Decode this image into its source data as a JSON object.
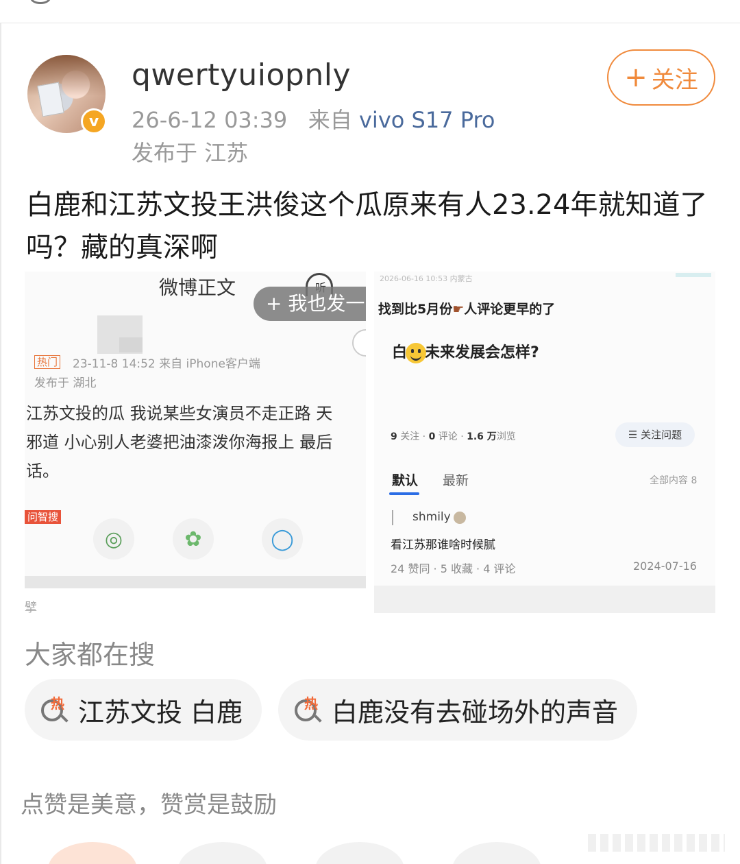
{
  "post": {
    "username": "qwertyuiopnly",
    "timestamp": "26-6-12 03:39",
    "source_prefix": "来自",
    "device": "vivo S17 Pro",
    "location": "发布于 江苏",
    "follow_label": "关注",
    "text": "白鹿和江苏文投王洪俊这个瓜原来有人23.24年就知道了吗？藏的真深啊"
  },
  "image1": {
    "title": "微博正文",
    "listen_label": "听",
    "pill_text": "+ 我也发一",
    "hot_tag": "热门",
    "meta": "23-11-8 14:52  来自 iPhone客户端",
    "location": "发布于 湖北",
    "body_lines": [
      "江苏文投的瓜 我说某些女演员不走正路 天",
      "邪道 小心别人老婆把油漆泼你海报上 最后",
      "话。"
    ],
    "wenzhi_tag": "问智搜",
    "below_char": "擘"
  },
  "image2": {
    "top_meta": "2026-06-16 10:53  内蒙古",
    "line1": "找到比5月份",
    "line1_b": "人评论更早的了",
    "question_a": "白",
    "question_b": "未来发展会怎样?",
    "stats": {
      "follow_num": "9",
      "follow_lbl": "关注",
      "comment_num": "0",
      "comment_lbl": "评论",
      "view_num": "1.6 万",
      "view_lbl": "浏览"
    },
    "follow_question": "关注问题",
    "tab_default": "默认",
    "tab_new": "最新",
    "all_content": "全部内容 8",
    "user": "shmily",
    "answer": "看江苏那谁啥时候腻",
    "footer": "24 赞同 · 5 收藏 · 4 评论",
    "date": "2024-07-16"
  },
  "search": {
    "title": "大家都在搜",
    "hot_mark": "热",
    "chips": [
      "江苏文投 白鹿",
      "白鹿没有去碰场外的声音"
    ]
  },
  "footer": {
    "text": "点赞是美意，赞赏是鼓励"
  },
  "colors": {
    "accent": "#f08a3c",
    "device_link": "#4a6a9c",
    "verified_badge": "#f5a623"
  }
}
